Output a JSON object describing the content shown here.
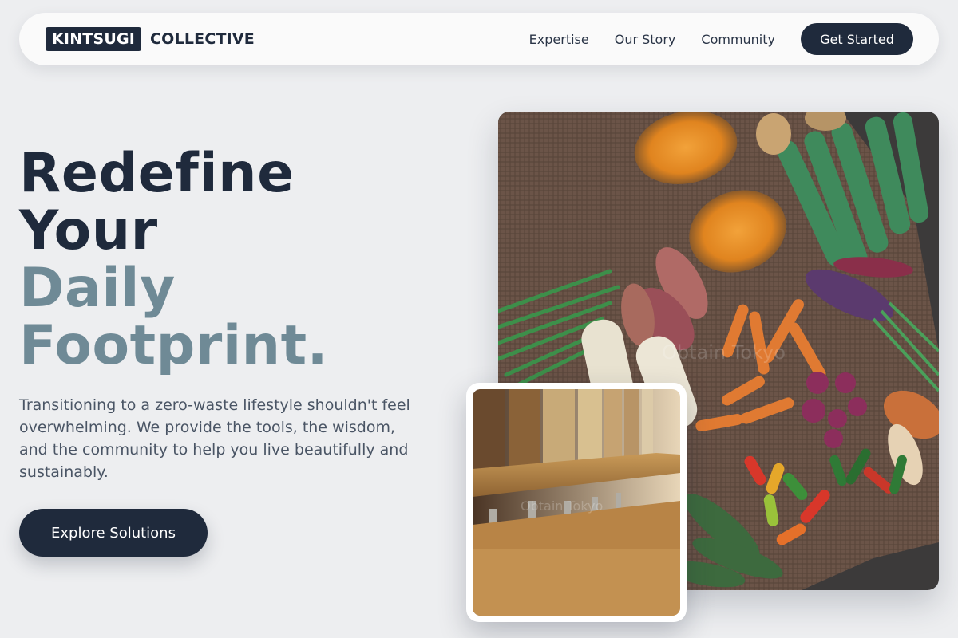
{
  "nav": {
    "logo_box": "KINTSUGI",
    "logo_text": "COLLECTIVE",
    "links": [
      "Expertise",
      "Our Story",
      "Community"
    ],
    "cta": "Get Started"
  },
  "hero": {
    "line1": "Redefine",
    "line2": "Your",
    "line3": "Daily",
    "line4": "Footprint.",
    "subtitle": "Transitioning to a zero-waste lifestyle shouldn't feel overwhelming. We provide the tools, the wisdom, and the community to help you live beautifully and sustainably.",
    "button": "Explore Solutions"
  },
  "images": {
    "main_watermark": "Obtain Tokyo",
    "small_watermark": "Obtain Tokyo"
  },
  "colors": {
    "dark": "#1f2a3c",
    "muted": "#6f8a96",
    "background": "#edeef0"
  }
}
